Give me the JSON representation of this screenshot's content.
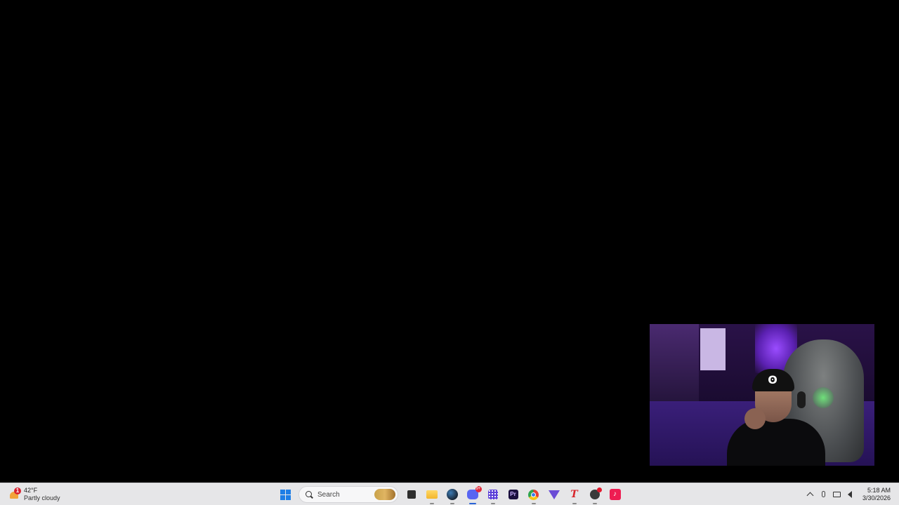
{
  "weather": {
    "alert_count": "1",
    "temperature": "42°F",
    "condition": "Partly cloudy",
    "icon": "partly-cloudy-icon"
  },
  "search": {
    "placeholder": "Search"
  },
  "taskbar_apps": [
    {
      "name": "start",
      "icon": "windows-logo-icon"
    },
    {
      "name": "task-view",
      "icon": "task-view-icon"
    },
    {
      "name": "file-explorer",
      "icon": "folder-icon"
    },
    {
      "name": "steam",
      "icon": "steam-icon"
    },
    {
      "name": "discord",
      "icon": "discord-icon",
      "badge": "9+",
      "active": true
    },
    {
      "name": "calculator",
      "icon": "calculator-icon"
    },
    {
      "name": "premiere-pro",
      "icon": "premiere-icon",
      "label": "Pr"
    },
    {
      "name": "chrome",
      "icon": "chrome-icon"
    },
    {
      "name": "vpn",
      "icon": "vpn-icon"
    },
    {
      "name": "t-app",
      "icon": "t-icon",
      "label": "T"
    },
    {
      "name": "obs",
      "icon": "obs-icon"
    },
    {
      "name": "tiktok",
      "icon": "tiktok-icon",
      "label": "♪"
    }
  ],
  "system_tray": {
    "icons": [
      "chevron-up-icon",
      "microphone-icon",
      "display-icon",
      "speaker-icon"
    ],
    "time": "5:18 AM",
    "date": "3/30/2026"
  },
  "colors": {
    "desktop_background": "#000000",
    "taskbar_background": "#e6e6e8",
    "accent": "#2a63d6"
  }
}
